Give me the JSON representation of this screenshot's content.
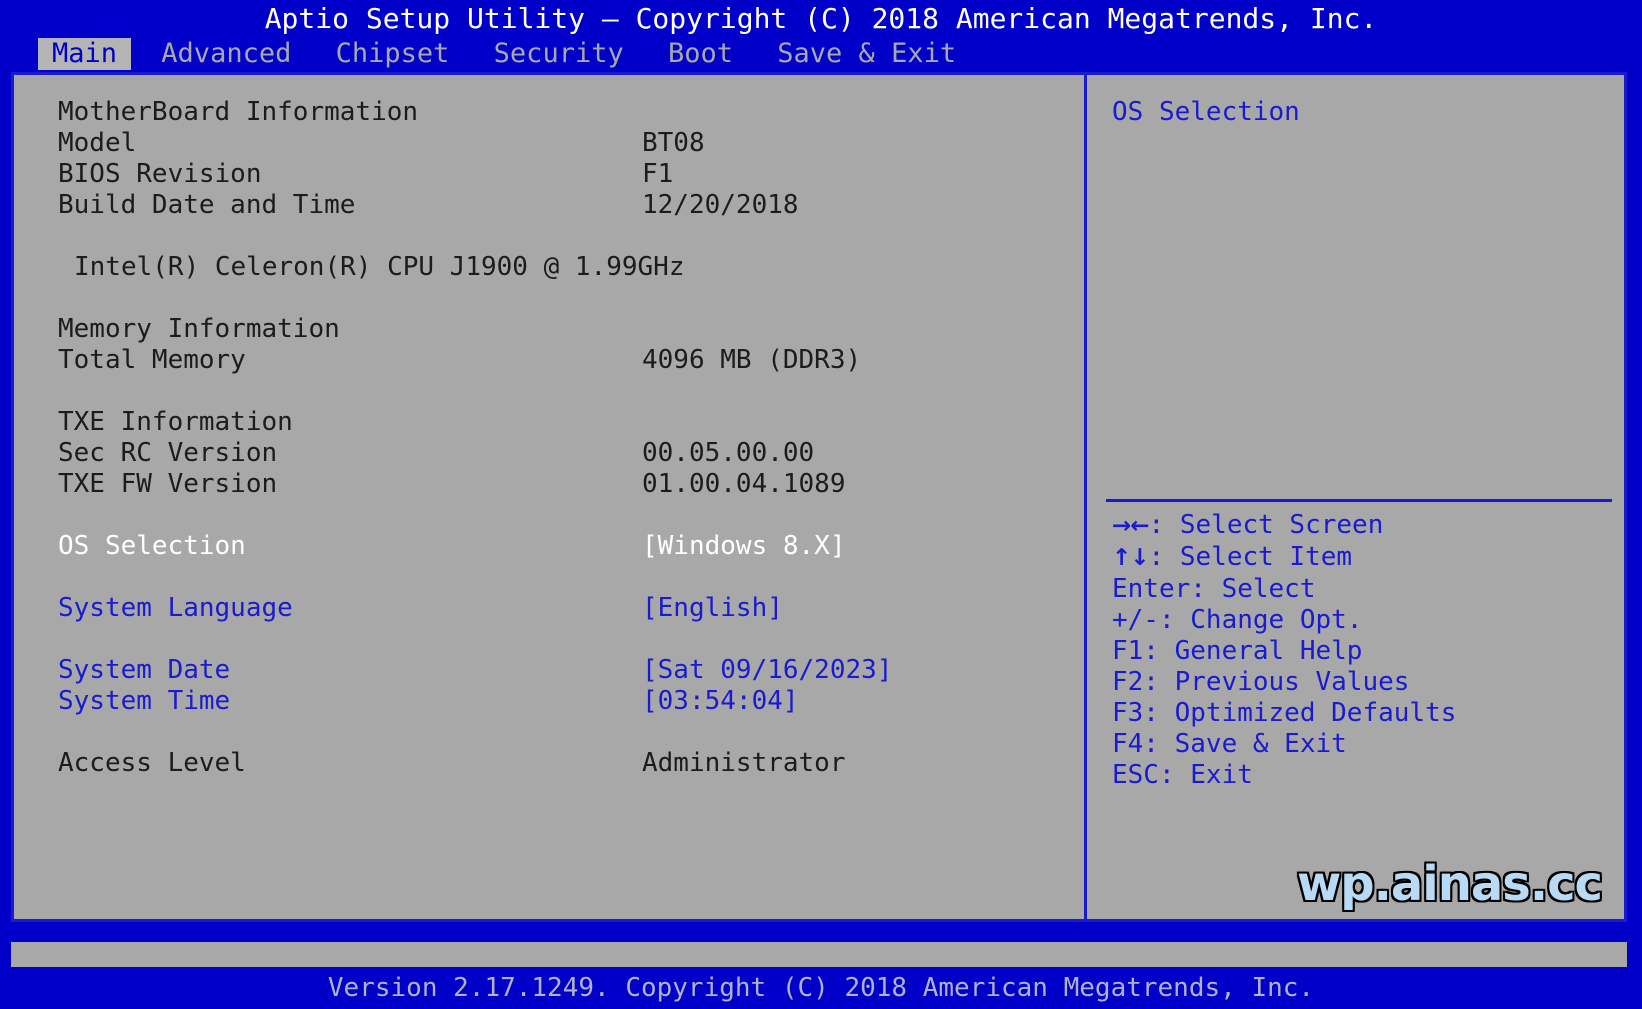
{
  "window": {
    "title": "Aptio Setup Utility – Copyright (C) 2018 American Megatrends, Inc.",
    "footer": "Version 2.17.1249. Copyright (C) 2018 American Megatrends, Inc.",
    "watermark": "wp.ainas.cc"
  },
  "tabs": [
    {
      "label": "Main",
      "active": true
    },
    {
      "label": "Advanced",
      "active": false
    },
    {
      "label": "Chipset",
      "active": false
    },
    {
      "label": "Security",
      "active": false
    },
    {
      "label": "Boot",
      "active": false
    },
    {
      "label": "Save & Exit",
      "active": false
    }
  ],
  "main": {
    "motherboard": {
      "heading": "MotherBoard Information",
      "model_label": "Model",
      "model_value": "BT08",
      "bios_revision_label": "BIOS Revision",
      "bios_revision_value": "F1",
      "build_date_label": "Build Date and Time",
      "build_date_value": "12/20/2018"
    },
    "cpu": {
      "line": "Intel(R) Celeron(R) CPU J1900 @ 1.99GHz"
    },
    "memory": {
      "heading": "Memory Information",
      "total_label": "Total Memory",
      "total_value": "4096 MB (DDR3)"
    },
    "txe": {
      "heading": "TXE Information",
      "sec_rc_label": "Sec RC Version",
      "sec_rc_value": "00.05.00.00",
      "fw_label": "TXE FW Version",
      "fw_value": "01.00.04.1089"
    },
    "settings": {
      "os_selection_label": "OS Selection",
      "os_selection_value": "[Windows 8.X]",
      "system_language_label": "System Language",
      "system_language_value": "[English]",
      "system_date_label": "System Date",
      "system_date_value": "[Sat 09/16/2023]",
      "system_time_label": "System Time",
      "system_time_value": "[03:54:04]",
      "access_level_label": "Access Level",
      "access_level_value": "Administrator"
    }
  },
  "help": {
    "title": "OS Selection",
    "legend": [
      {
        "keys": "→←",
        "text": ": Select Screen"
      },
      {
        "keys": "↑↓",
        "text": ": Select Item"
      },
      {
        "keys": "",
        "text": "Enter: Select"
      },
      {
        "keys": "",
        "text": "+/-: Change Opt."
      },
      {
        "keys": "",
        "text": "F1: General Help"
      },
      {
        "keys": "",
        "text": "F2: Previous Values"
      },
      {
        "keys": "",
        "text": "F3: Optimized Defaults"
      },
      {
        "keys": "",
        "text": "F4: Save & Exit"
      },
      {
        "keys": "",
        "text": "ESC: Exit"
      }
    ]
  },
  "colors": {
    "screen_blue": "#0000c8",
    "panel_gray": "#a8a8a8",
    "border_blue": "#1a1ad0",
    "text_dark": "#1c1c1c",
    "text_blue": "#1a1ad0",
    "text_selected": "#ffffff",
    "watermark_fill": "#b9daf4"
  }
}
